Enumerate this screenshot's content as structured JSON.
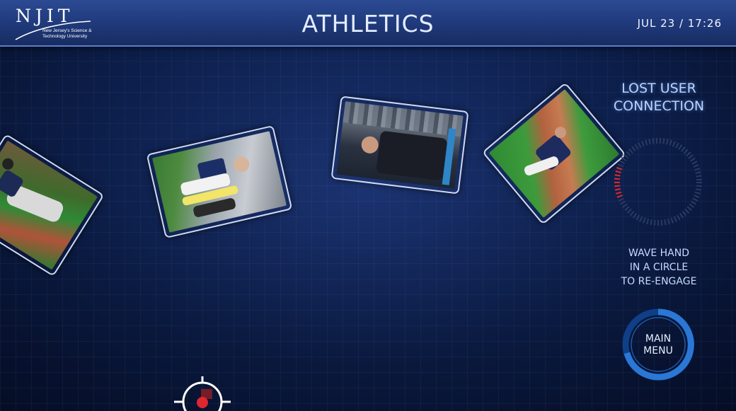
{
  "header": {
    "logo": {
      "letters": "NJIT",
      "line1": "New Jersey's Science &",
      "line2": "Technology University"
    },
    "title": "ATHLETICS",
    "datetime": "JUL  23 / 17:26"
  },
  "status": {
    "lost_line1": "LOST USER",
    "lost_line2": "CONNECTION",
    "wave_line1": "WAVE HAND",
    "wave_line2": "IN A CIRCLE",
    "wave_line3": "TO RE-ENGAGE",
    "reengage_progress": 0.12
  },
  "menu": {
    "line1": "MAIN",
    "line2": "MENU"
  },
  "photos": [
    "baseball-batter",
    "soccer-team-walkout",
    "coach-interview",
    "baseball-pitcher"
  ],
  "colors": {
    "accent": "#5a7fcf",
    "warning": "#e0262e",
    "ring": "#2a77d6",
    "text": "#cfe0ff"
  }
}
